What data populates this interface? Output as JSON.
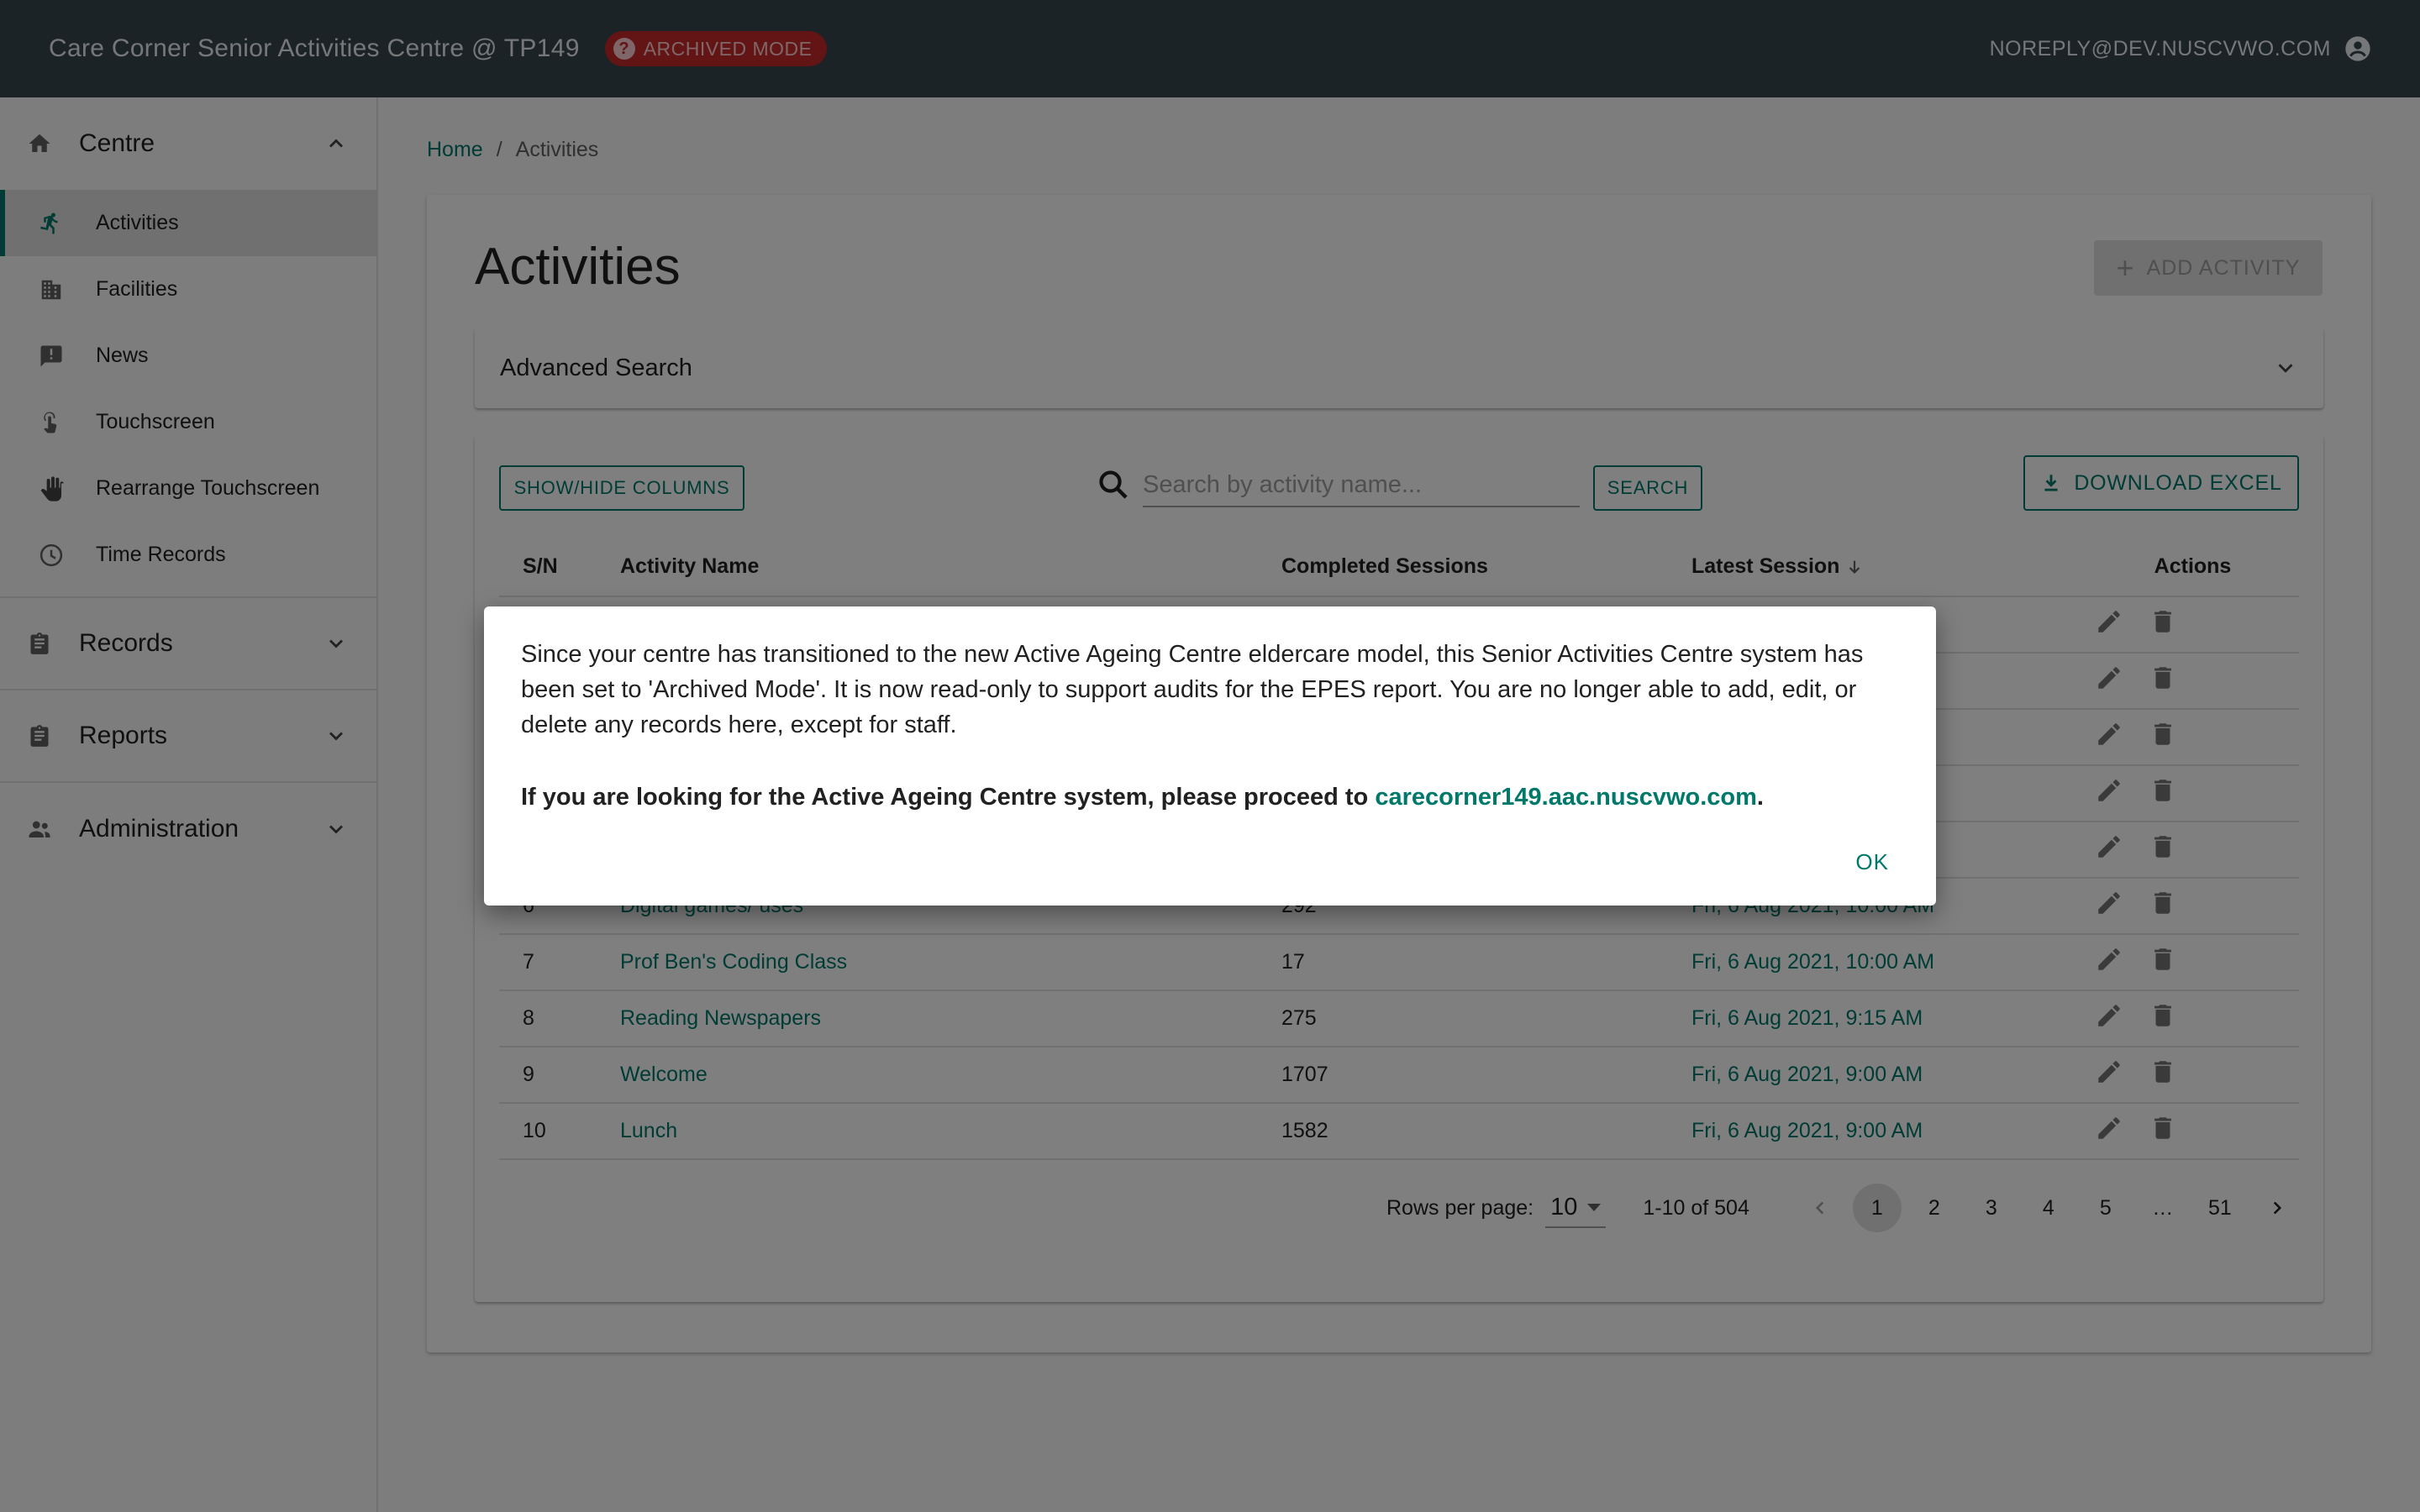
{
  "topbar": {
    "title": "Care Corner Senior Activities Centre @ TP149",
    "badge": "ARCHIVED MODE",
    "user_email": "NOREPLY@DEV.NUSCVWO.COM"
  },
  "sidebar": {
    "centre_label": "Centre",
    "items": [
      {
        "label": "Activities",
        "icon": "run-icon"
      },
      {
        "label": "Facilities",
        "icon": "building-icon"
      },
      {
        "label": "News",
        "icon": "announcement-icon"
      },
      {
        "label": "Touchscreen",
        "icon": "touch-icon"
      },
      {
        "label": "Rearrange Touchscreen",
        "icon": "hand-icon"
      },
      {
        "label": "Time Records",
        "icon": "clock-icon"
      }
    ],
    "records_label": "Records",
    "reports_label": "Reports",
    "administration_label": "Administration"
  },
  "breadcrumb": {
    "home": "Home",
    "separator": "/",
    "current": "Activities"
  },
  "page": {
    "title": "Activities",
    "add_button": "ADD ACTIVITY",
    "advanced_search": "Advanced Search",
    "show_hide": "SHOW/HIDE COLUMNS",
    "search_placeholder": "Search by activity name...",
    "search_button": "SEARCH",
    "download_button": "DOWNLOAD EXCEL"
  },
  "table": {
    "headers": {
      "sn": "S/N",
      "name": "Activity Name",
      "completed": "Completed Sessions",
      "latest": "Latest Session",
      "actions": "Actions"
    },
    "rows": [
      {
        "sn": "",
        "name": "",
        "completed": "",
        "latest": "AM"
      },
      {
        "sn": "",
        "name": "",
        "completed": "",
        "latest": "M"
      },
      {
        "sn": "",
        "name": "",
        "completed": "",
        "latest": "M"
      },
      {
        "sn": "",
        "name": "",
        "completed": "",
        "latest": "M"
      },
      {
        "sn": "",
        "name": "",
        "completed": "",
        "latest": "AM"
      },
      {
        "sn": "6",
        "name": "Digital games/ uses",
        "completed": "292",
        "latest": "Fri, 6 Aug 2021, 10:00 AM"
      },
      {
        "sn": "7",
        "name": "Prof Ben's Coding Class",
        "completed": "17",
        "latest": "Fri, 6 Aug 2021, 10:00 AM"
      },
      {
        "sn": "8",
        "name": "Reading Newspapers",
        "completed": "275",
        "latest": "Fri, 6 Aug 2021, 9:15 AM"
      },
      {
        "sn": "9",
        "name": "Welcome",
        "completed": "1707",
        "latest": "Fri, 6 Aug 2021, 9:00 AM"
      },
      {
        "sn": "10",
        "name": "Lunch",
        "completed": "1582",
        "latest": "Fri, 6 Aug 2021, 9:00 AM"
      }
    ]
  },
  "pagination": {
    "rows_per_page_label": "Rows per page:",
    "rows_per_page": "10",
    "range": "1-10 of 504",
    "pages": [
      "1",
      "2",
      "3",
      "4",
      "5",
      "…",
      "51"
    ],
    "current": "1"
  },
  "dialog": {
    "message": "Since your centre has transitioned to the new Active Ageing Centre eldercare model, this Senior Activities Centre system has been set to 'Archived Mode'. It is now read-only to support audits for the EPES report. You are no longer able to add, edit, or delete any records here, except for staff.",
    "proceed_text": "If you are looking for the Active Ageing Centre system, please proceed to ",
    "link": "carecorner149.aac.nuscvwo.com",
    "period": ".",
    "ok": "OK"
  },
  "colors": {
    "topbar": "#37474f",
    "accent": "#00796b",
    "badge": "#c62828"
  }
}
